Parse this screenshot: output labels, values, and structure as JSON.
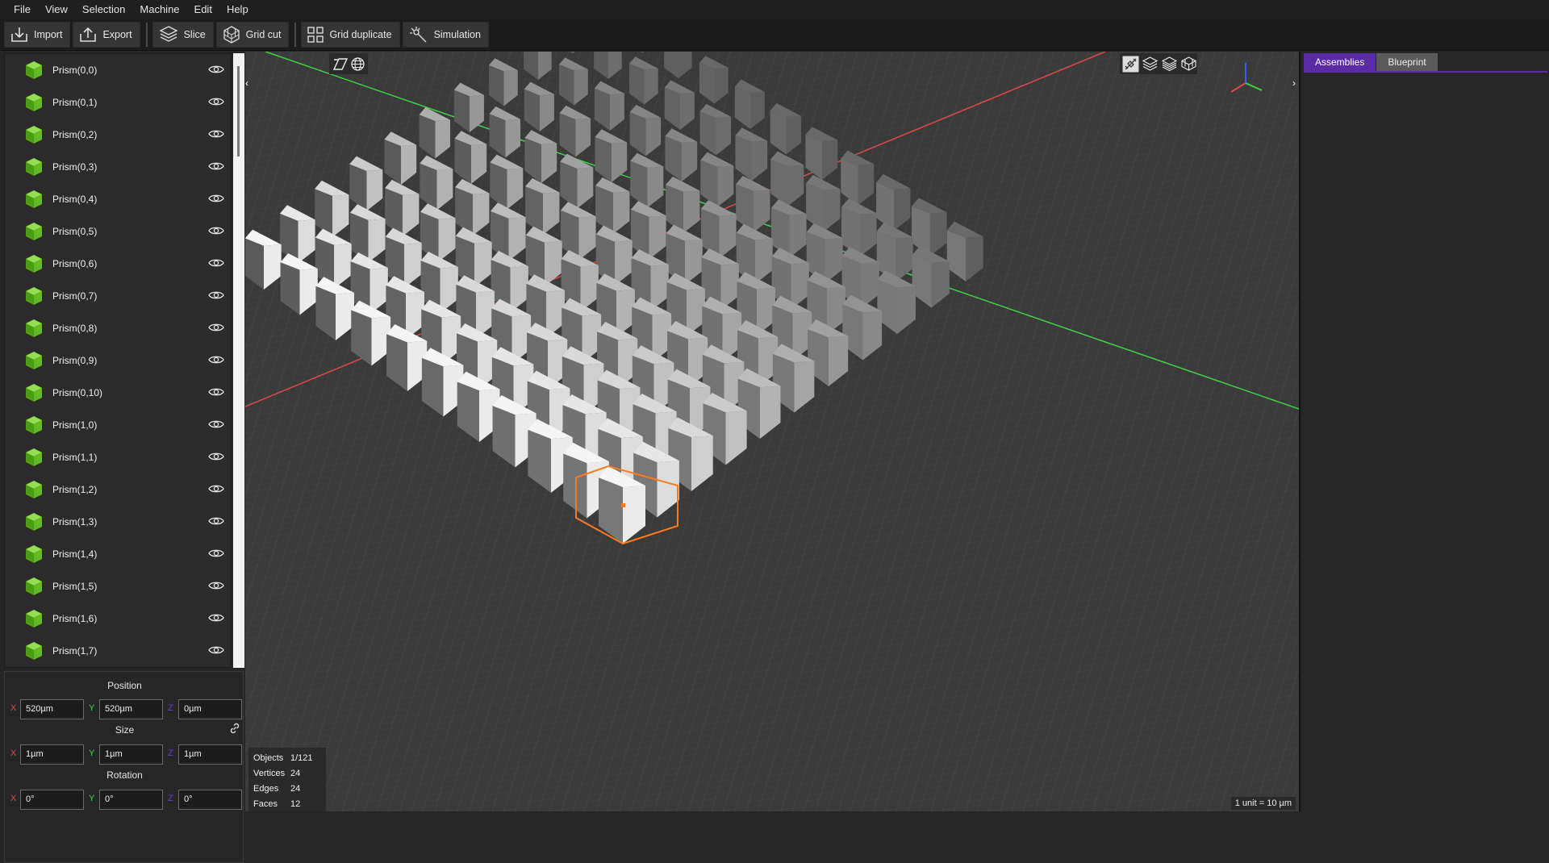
{
  "menu": [
    "File",
    "View",
    "Selection",
    "Machine",
    "Edit",
    "Help"
  ],
  "toolbar": {
    "import": "Import",
    "export": "Export",
    "slice": "Slice",
    "grid_cut": "Grid cut",
    "grid_duplicate": "Grid duplicate",
    "simulation": "Simulation"
  },
  "tree": {
    "items": [
      "Prism(0,0)",
      "Prism(0,1)",
      "Prism(0,2)",
      "Prism(0,3)",
      "Prism(0,4)",
      "Prism(0,5)",
      "Prism(0,6)",
      "Prism(0,7)",
      "Prism(0,8)",
      "Prism(0,9)",
      "Prism(0,10)",
      "Prism(1,0)",
      "Prism(1,1)",
      "Prism(1,2)",
      "Prism(1,3)",
      "Prism(1,4)",
      "Prism(1,5)",
      "Prism(1,6)",
      "Prism(1,7)"
    ]
  },
  "properties": {
    "position_title": "Position",
    "size_title": "Size",
    "rotation_title": "Rotation",
    "axis_x": "X",
    "axis_y": "Y",
    "axis_z": "Z",
    "position": {
      "x": "520µm",
      "y": "520µm",
      "z": "0µm"
    },
    "size": {
      "x": "1µm",
      "y": "1µm",
      "z": "1µm"
    },
    "rotation": {
      "x": "0°",
      "y": "0°",
      "z": "0°"
    }
  },
  "right_panel": {
    "tabs": [
      "Assemblies",
      "Blueprint"
    ],
    "active_tab": "Assemblies"
  },
  "stats": {
    "objects_label": "Objects",
    "objects": "1/121",
    "vertices_label": "Vertices",
    "vertices": "24",
    "edges_label": "Edges",
    "edges": "24",
    "faces_label": "Faces",
    "faces": "12"
  },
  "scale_label": "1 unit = 10 µm",
  "colors": {
    "accent": "#5b2ba6",
    "cube_icon": "#5fb51f",
    "selection": "#ff7a1a",
    "axis_x": "#e04848",
    "axis_y": "#3fd24a",
    "axis_z": "#3a5cff"
  }
}
